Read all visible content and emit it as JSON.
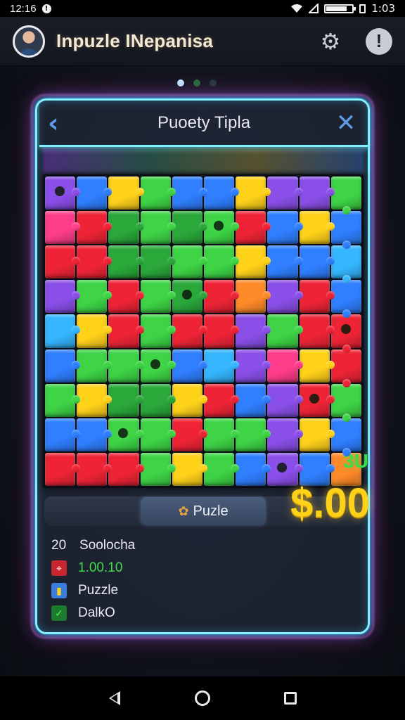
{
  "status_bar": {
    "time": "12:16",
    "alert_icon": "alert-circle-icon",
    "battery_time": "1:03",
    "battery_level_percent": 80
  },
  "header": {
    "title": "Inpuzle INepanisa",
    "settings_icon": "gear-icon",
    "info_icon": "info-icon"
  },
  "pager": {
    "count": 3,
    "active_index": 0,
    "colors": [
      "#bfe6ff",
      "#1f6a3a",
      "#1e3b36"
    ]
  },
  "panel": {
    "title": "Puoety Tipla",
    "back_icon": "chevron-left-icon",
    "close_icon": "close-icon"
  },
  "colors": {
    "purple": "#8a4fe8",
    "blue": "#2f7fff",
    "yellow": "#ffd21a",
    "green": "#3ed446",
    "dgreen": "#2aa83a",
    "red": "#ee2436",
    "pink": "#ff3d8a",
    "orange": "#ff8a2a",
    "cyan": "#35b6ff"
  },
  "puzzle_grid": [
    [
      "purple",
      "blue",
      "yellow",
      "green",
      "blue",
      "blue",
      "yellow",
      "purple",
      "purple",
      "green"
    ],
    [
      "pink",
      "red",
      "dgreen",
      "green",
      "dgreen",
      "green",
      "red",
      "blue",
      "yellow",
      "blue"
    ],
    [
      "red",
      "red",
      "dgreen",
      "dgreen",
      "green",
      "green",
      "yellow",
      "blue",
      "blue",
      "cyan"
    ],
    [
      "purple",
      "green",
      "red",
      "green",
      "dgreen",
      "red",
      "orange",
      "purple",
      "red",
      "blue"
    ],
    [
      "cyan",
      "yellow",
      "red",
      "green",
      "red",
      "red",
      "purple",
      "green",
      "red",
      "red"
    ],
    [
      "blue",
      "green",
      "green",
      "green",
      "blue",
      "cyan",
      "purple",
      "pink",
      "yellow",
      "red"
    ],
    [
      "green",
      "yellow",
      "dgreen",
      "dgreen",
      "yellow",
      "red",
      "blue",
      "purple",
      "red",
      "green"
    ],
    [
      "blue",
      "blue",
      "green",
      "green",
      "red",
      "green",
      "green",
      "purple",
      "yellow",
      "blue"
    ],
    [
      "red",
      "red",
      "red",
      "green",
      "yellow",
      "green",
      "blue",
      "purple",
      "blue",
      "orange"
    ]
  ],
  "tabs": {
    "active_label": "Puzle",
    "active_icon": "puzzle-piece-icon"
  },
  "stats": {
    "row1": {
      "num": "20",
      "label": "Soolocha"
    },
    "row2": {
      "icon": "map-marker-icon",
      "value": "1.00.10"
    },
    "row3": {
      "icon": "bar-chart-icon",
      "label": "Puzzle"
    },
    "row4": {
      "icon": "check-icon",
      "label": "DalkO"
    }
  },
  "score": {
    "value": "3U",
    "money": "$.00"
  },
  "nav": {
    "back_icon": "back-triangle-icon",
    "home_icon": "home-circle-icon",
    "recents_icon": "recents-square-icon"
  }
}
